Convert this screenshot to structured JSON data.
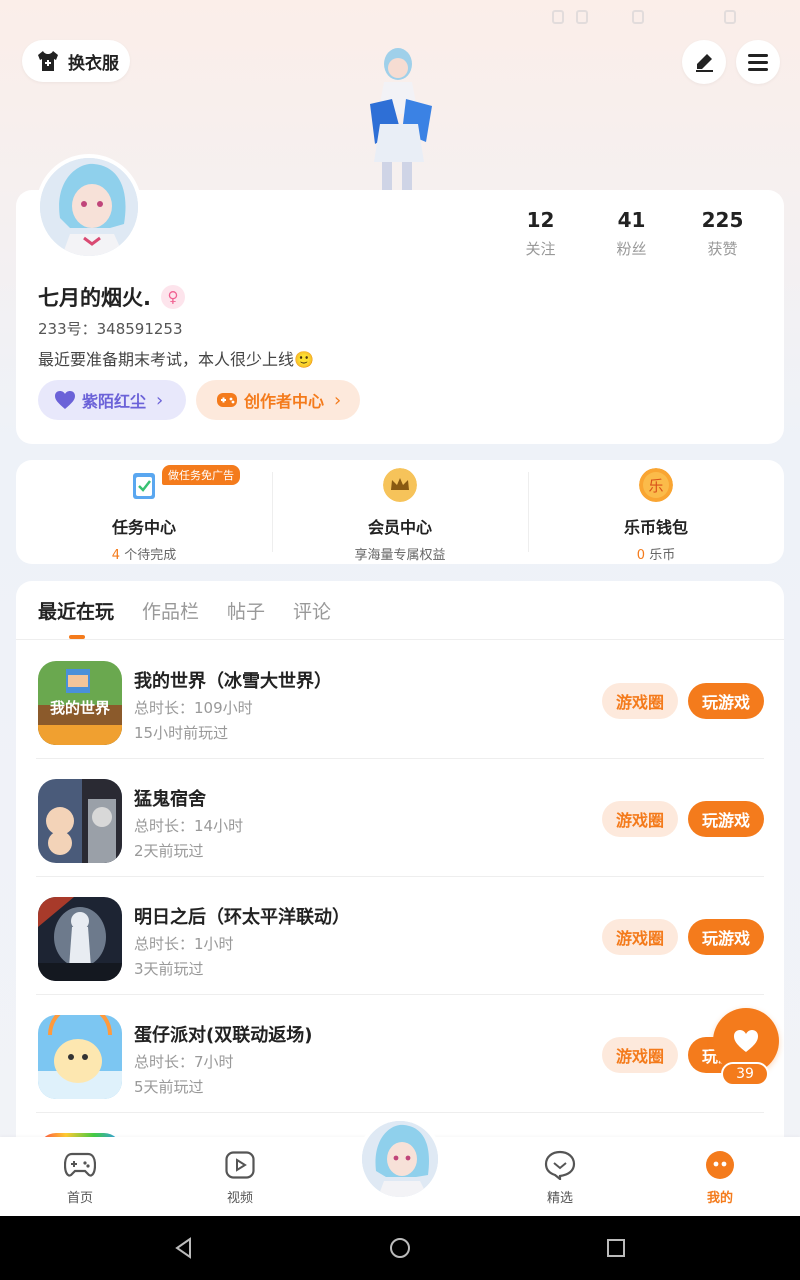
{
  "header": {
    "outfit_label": "换衣服",
    "edit_icon": "pencil-icon",
    "menu_icon": "hamburger-menu-icon"
  },
  "profile": {
    "stats": [
      {
        "value": "12",
        "label": "关注"
      },
      {
        "value": "41",
        "label": "粉丝"
      },
      {
        "value": "225",
        "label": "获赞"
      }
    ],
    "nickname": "七月的烟火.",
    "gender_icon": "female-icon",
    "uid": "233号：348591253",
    "bio": "最近要准备期末考试，本人很少上线🙂",
    "pill_left": "紫陌红尘",
    "pill_right": "创作者中心"
  },
  "services": [
    {
      "title": "任务中心",
      "count": "4",
      "suffix": " 个待完成",
      "badge": "做任务免广告"
    },
    {
      "title": "会员中心",
      "sub": "享海量专属权益"
    },
    {
      "title": "乐币钱包",
      "count": "0",
      "suffix": " 乐币"
    }
  ],
  "tabs": [
    "最近在玩",
    "作品栏",
    "帖子",
    "评论"
  ],
  "games": [
    {
      "name": "我的世界（冰雪大世界）",
      "time": "总时长：109小时",
      "last": "15小时前玩过"
    },
    {
      "name": "猛鬼宿舍",
      "time": "总时长：14小时",
      "last": "2天前玩过"
    },
    {
      "name": "明日之后（环太平洋联动）",
      "time": "总时长：1小时",
      "last": "3天前玩过"
    },
    {
      "name": "蛋仔派对(双联动返场)",
      "time": "总时长：7小时",
      "last": "5天前玩过"
    }
  ],
  "game_buttons": {
    "circle": "游戏圈",
    "play": "玩游戏"
  },
  "fab": {
    "count": "39"
  },
  "bottom_nav": [
    {
      "label": "首页",
      "icon": "gamepad-icon"
    },
    {
      "label": "视频",
      "icon": "video-play-icon"
    },
    {
      "label": "精选",
      "icon": "heart-chat-icon"
    },
    {
      "label": "我的",
      "icon": "face-icon"
    }
  ],
  "colors": {
    "accent": "#f47b1c",
    "purple": "#6b62d8"
  }
}
